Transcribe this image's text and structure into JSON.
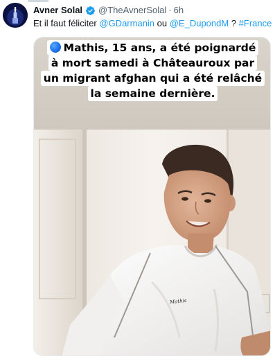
{
  "author": {
    "name": "Avner Solal",
    "handle": "@TheAvnerSolal",
    "separator": "·",
    "time": "6h"
  },
  "tweet": {
    "text_before": "Et il faut féliciter ",
    "mention_1": "@GDarmanin",
    "text_middle": " ou ",
    "mention_2": "@E_DupondM",
    "text_after": " ? ",
    "hashtag": "#France"
  },
  "media": {
    "caption_lines": [
      "Mathis, 15 ans, a été poignardé",
      "à mort samedi à Châteauroux par",
      "un migrant afghan qui a été relâché",
      "la semaine dernière."
    ],
    "shirt_logo_text": "Mathis",
    "colors": {
      "caption_background": "#d6d0c8",
      "caption_box": "#ffffff",
      "blue_circle": "#1a6ee8"
    }
  },
  "icons": {
    "verified": "verified-badge-icon",
    "avatar": "avatar-image",
    "caption_marker": "blue-circle-icon"
  },
  "colors": {
    "link": "#1d9bf0",
    "text_primary": "#0f1419",
    "text_secondary": "#536471",
    "verified_badge": "#1d9bf0"
  }
}
